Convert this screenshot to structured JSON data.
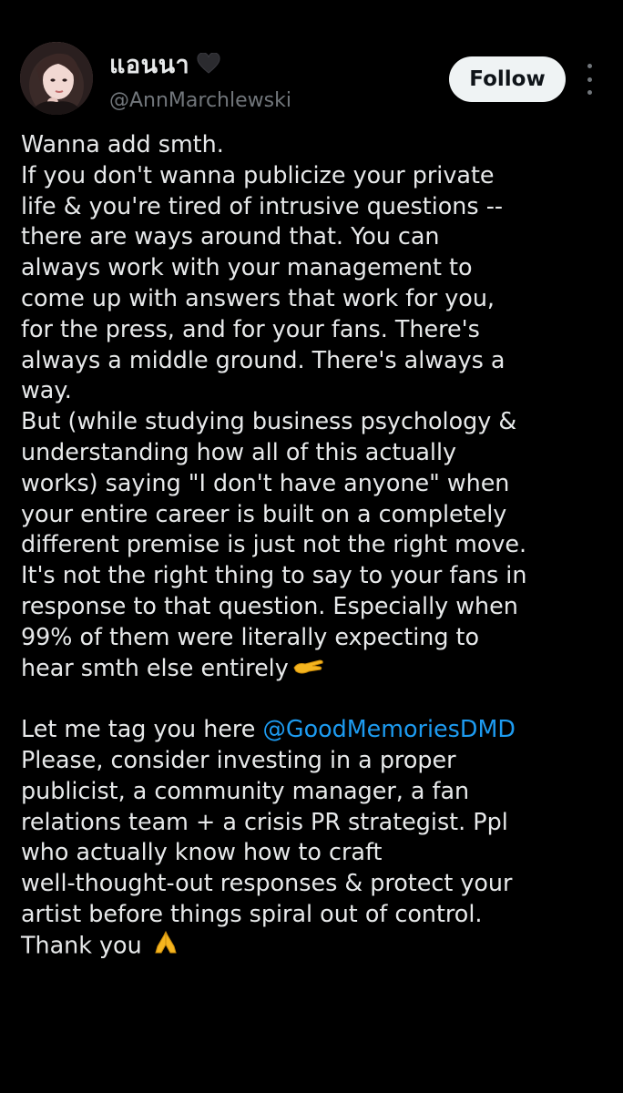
{
  "user": {
    "display_name": "แอนนา",
    "name_emoji": "black-heart",
    "handle": "@AnnMarchlewski"
  },
  "header": {
    "follow_label": "Follow",
    "more_icon": "more-vertical-icon"
  },
  "tweet": {
    "lines": [
      "Wanna add smth.",
      "If you don't wanna publicize your private",
      "life & you're tired of intrusive questions --",
      "there are ways around that. You can",
      "always work with your management to",
      "come up with answers that work for you,",
      "for the press, and for your fans. There's",
      "always a middle ground. There's always a",
      "way.",
      "But (while studying business psychology &",
      "understanding how all of this actually",
      "works) saying \"I don't have anyone\" when",
      "your entire career is built on a completely",
      "different premise is just not the right move.",
      "It's not the right thing to say to your fans in",
      "response to that question. Especially when",
      "99% of them were literally expecting to",
      "hear smth else entirely"
    ],
    "line_end_emoji": "hand-pointing-emoji",
    "tag_prefix": "Let me tag you here ",
    "mention": "@GoodMemoriesDMD",
    "lines2": [
      "Please, consider investing in a proper",
      "publicist, a community manager, a fan",
      "relations team + a crisis PR strategist. Ppl",
      "who actually know how to craft",
      "well-thought-out responses & protect your",
      "artist before things spiral out of control."
    ],
    "closing": "Thank you",
    "closing_emoji": "folded-hands-emoji"
  },
  "colors": {
    "background": "#000000",
    "text": "#e7e9ea",
    "secondary": "#71767b",
    "link": "#1d9bf0",
    "follow_bg": "#eff3f4"
  }
}
